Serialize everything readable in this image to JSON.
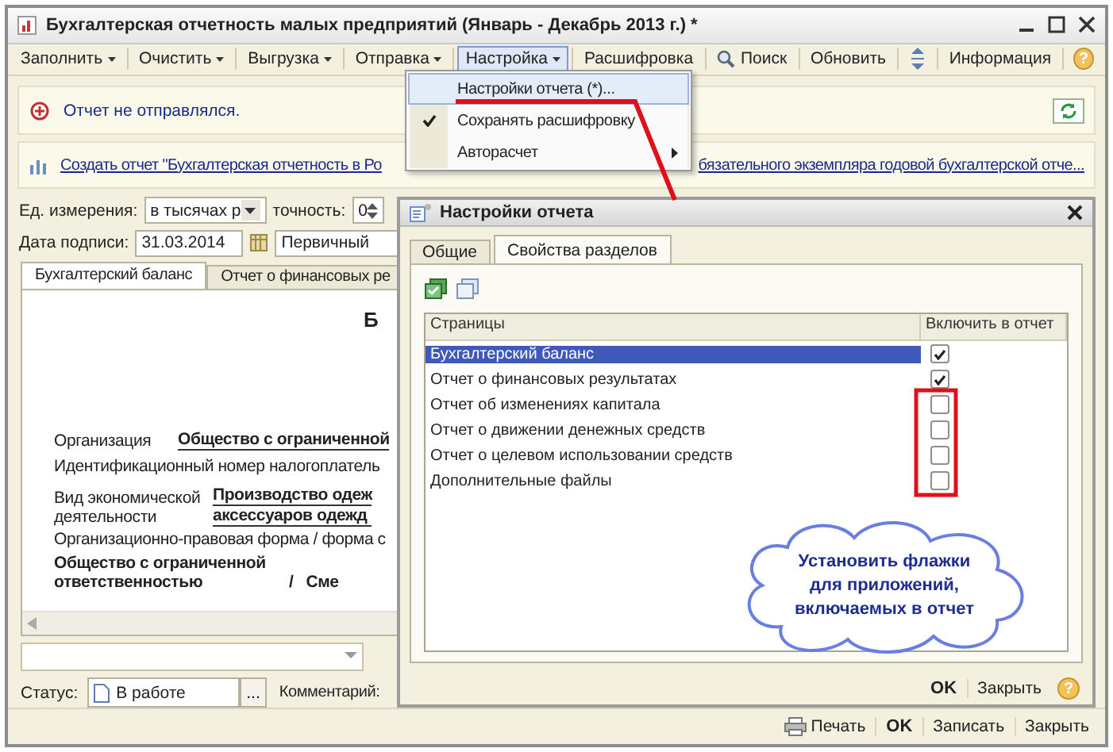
{
  "window": {
    "title": "Бухгалтерская отчетность малых предприятий (Январь - Декабрь 2013 г.) *"
  },
  "toolbar": [
    {
      "kind": "dropdown",
      "label": "Заполнить",
      "selected": false
    },
    {
      "kind": "dropdown",
      "label": "Очистить",
      "selected": false
    },
    {
      "kind": "dropdown",
      "label": "Выгрузка",
      "selected": false
    },
    {
      "kind": "dropdown",
      "label": "Отправка",
      "selected": false
    },
    {
      "kind": "dropdown",
      "label": "Настройка",
      "selected": true
    },
    {
      "kind": "button",
      "label": "Расшифровка",
      "selected": false
    },
    {
      "kind": "search",
      "label": "Поиск",
      "selected": false
    },
    {
      "kind": "button",
      "label": "Обновить",
      "selected": false
    },
    {
      "kind": "arrows",
      "selected": false
    },
    {
      "kind": "button",
      "label": "Информация",
      "selected": false
    },
    {
      "kind": "help",
      "label": "?",
      "selected": false
    }
  ],
  "menu": {
    "items": [
      {
        "label": "Настройки отчета (*)...",
        "selected": true,
        "checked": false,
        "submenu": false
      },
      {
        "label": "Сохранять расшифровку",
        "selected": false,
        "checked": true,
        "submenu": false
      },
      {
        "label": "Авторасчет",
        "selected": false,
        "checked": false,
        "submenu": true
      }
    ]
  },
  "notices": {
    "status_text": "Отчет не отправлялся.",
    "link_start": "Создать отчет \"Бухгалтерская отчетность в Ро",
    "link_end": "бязательного экземпляра годовой бухгалтерской отче..."
  },
  "form": {
    "units_label": "Ед. измерения:",
    "units_value": "в тысячах р",
    "precision_label": "точность:",
    "precision_value": "0",
    "date_label": "Дата подписи:",
    "date_value": "31.03.2014",
    "type_value": "Первичный"
  },
  "report_tabs": [
    {
      "label": "Бухгалтерский баланс",
      "selected": true
    },
    {
      "label": "Отчет о финансовых ре",
      "selected": false
    }
  ],
  "document": {
    "heading": "Б",
    "org_label": "Организация",
    "org_value": "Общество с ограниченной",
    "inn_label": "Идентификационный номер налогоплатель",
    "activity_label": [
      "Вид экономической",
      "деятельности"
    ],
    "activity_value": [
      "Производство одеж",
      "аксессуаров одежд"
    ],
    "legal_form_label": "Организационно-правовая форма / форма с",
    "legal_form_value": [
      "Общество с ограниченной",
      "ответственностью"
    ],
    "slash": "/",
    "ownership_value": "Сме"
  },
  "status_bar": {
    "status_label": "Статус:",
    "status_value": "В работе",
    "more": "...",
    "comment_label": "Комментарий:"
  },
  "footer_buttons": [
    {
      "kind": "print",
      "label": "Печать"
    },
    {
      "kind": "default",
      "label": "OK"
    },
    {
      "kind": "plain",
      "label": "Записать"
    },
    {
      "kind": "plain",
      "label": "Закрыть"
    }
  ],
  "dialog": {
    "title": "Настройки отчета",
    "tabs": [
      {
        "label": "Общие",
        "selected": false
      },
      {
        "label": "Свойства разделов",
        "selected": true
      }
    ],
    "columns": [
      "Страницы",
      "Включить в отчет"
    ],
    "rows": [
      {
        "name": "Бухгалтерский баланс",
        "selected": true,
        "checked": true
      },
      {
        "name": "Отчет о финансовых результатах",
        "selected": false,
        "checked": true
      },
      {
        "name": "Отчет об изменениях капитала",
        "selected": false,
        "checked": false
      },
      {
        "name": "Отчет о движении денежных средств",
        "selected": false,
        "checked": false
      },
      {
        "name": "Отчет о целевом использовании средств",
        "selected": false,
        "checked": false
      },
      {
        "name": "Дополнительные файлы",
        "selected": false,
        "checked": false
      }
    ],
    "buttons": [
      {
        "kind": "default",
        "label": "OK"
      },
      {
        "kind": "plain",
        "label": "Закрыть"
      },
      {
        "kind": "help",
        "label": "?"
      }
    ]
  },
  "callout": {
    "text": "Установить флажки для приложений, включаемых в отчет"
  }
}
